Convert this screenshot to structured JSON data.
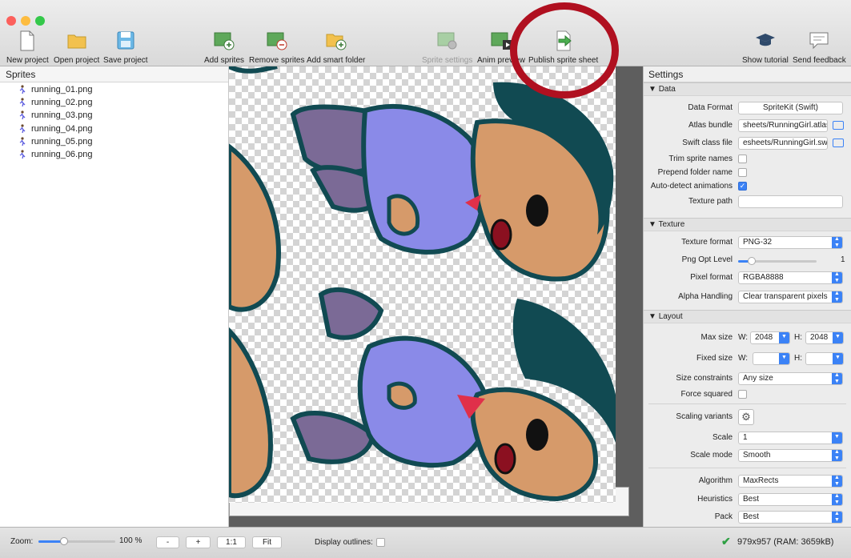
{
  "toolbar": {
    "new_project": "New project",
    "open_project": "Open project",
    "save_project": "Save project",
    "add_sprites": "Add sprites",
    "remove_sprites": "Remove sprites",
    "add_smart_folder": "Add smart folder",
    "sprite_settings": "Sprite settings",
    "anim_preview": "Anim preview",
    "publish_sprite_sheet": "Publish sprite sheet",
    "show_tutorial": "Show tutorial",
    "send_feedback": "Send feedback"
  },
  "sprites": {
    "title": "Sprites",
    "items": [
      "running_01.png",
      "running_02.png",
      "running_03.png",
      "running_04.png",
      "running_05.png",
      "running_06.png"
    ]
  },
  "settings": {
    "title": "Settings",
    "data": {
      "section": "Data",
      "data_format_label": "Data Format",
      "data_format_value": "SpriteKit (Swift)",
      "atlas_bundle_label": "Atlas bundle",
      "atlas_bundle_value": "sheets/RunningGirl.atlasc",
      "swift_class_label": "Swift class file",
      "swift_class_value": "esheets/RunningGirl.swift",
      "trim_label": "Trim sprite names",
      "prepend_label": "Prepend folder name",
      "autodetect_label": "Auto-detect animations",
      "texture_path_label": "Texture path",
      "texture_path_value": ""
    },
    "texture": {
      "section": "Texture",
      "format_label": "Texture format",
      "format_value": "PNG-32",
      "png_opt_label": "Png Opt Level",
      "png_opt_value": "1",
      "pixel_format_label": "Pixel format",
      "pixel_format_value": "RGBA8888",
      "alpha_label": "Alpha Handling",
      "alpha_value": "Clear transparent pixels"
    },
    "layout": {
      "section": "Layout",
      "max_size_label": "Max size",
      "w_label": "W:",
      "h_label": "H:",
      "max_w": "2048",
      "max_h": "2048",
      "fixed_size_label": "Fixed size",
      "size_constraints_label": "Size constraints",
      "size_constraints_value": "Any size",
      "force_squared_label": "Force squared",
      "scaling_variants_label": "Scaling variants",
      "scale_label": "Scale",
      "scale_value": "1",
      "scale_mode_label": "Scale mode",
      "scale_mode_value": "Smooth",
      "algorithm_label": "Algorithm",
      "algorithm_value": "MaxRects",
      "heuristics_label": "Heuristics",
      "heuristics_value": "Best",
      "pack_label": "Pack",
      "pack_value": "Best"
    }
  },
  "bottom": {
    "zoom_label": "Zoom:",
    "zoom_value": "100 %",
    "zoom_level": 0.33,
    "minus": "-",
    "plus": "+",
    "one_to_one": "1:1",
    "fit": "Fit",
    "display_outlines": "Display outlines:",
    "status": "979x957 (RAM: 3659kB)"
  },
  "colors": {
    "accent": "#3b82f6",
    "highlight_ring": "#b01020",
    "status_ok": "#2ea043"
  }
}
